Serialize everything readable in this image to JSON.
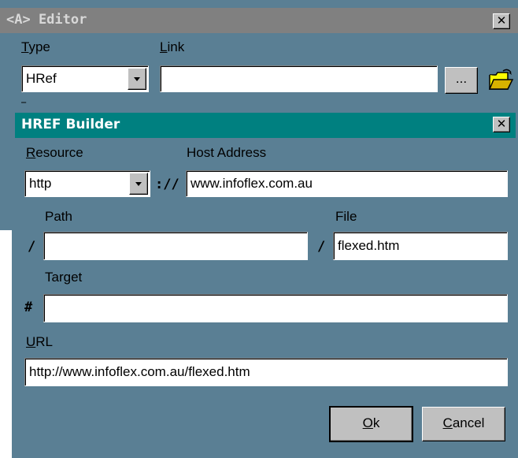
{
  "editor": {
    "title": "<A> Editor",
    "close_glyph": "✕",
    "type_label_first": "T",
    "type_label_rest": "ype",
    "link_label_first": "L",
    "link_label_rest": "ink",
    "type_value": "HRef",
    "link_value": "",
    "browse_label": "...",
    "folder_icon": "open-folder-icon"
  },
  "builder": {
    "title": "HREF Builder",
    "close_glyph": "✕",
    "resource_label_first": "R",
    "resource_label_rest": "esource",
    "resource_value": "http",
    "protocol_separator": "://",
    "host_label": "Host Address",
    "host_value": "www.infoflex.com.au",
    "path_label": "Path",
    "path_prefix": "/",
    "path_value": "",
    "file_label": "File",
    "file_prefix": "/",
    "file_value": "flexed.htm",
    "target_label": "Target",
    "target_prefix": "#",
    "target_value": "",
    "url_label_first": "U",
    "url_label_rest": "RL",
    "url_value": "http://www.infoflex.com.au/flexed.htm",
    "ok_first": "O",
    "ok_rest": "k",
    "cancel_first": "C",
    "cancel_rest": "ancel"
  },
  "colors": {
    "editor_bg": "#5a7f94",
    "editor_title": "#808080",
    "builder_title": "#008080",
    "button_face": "#c0c0c0"
  }
}
